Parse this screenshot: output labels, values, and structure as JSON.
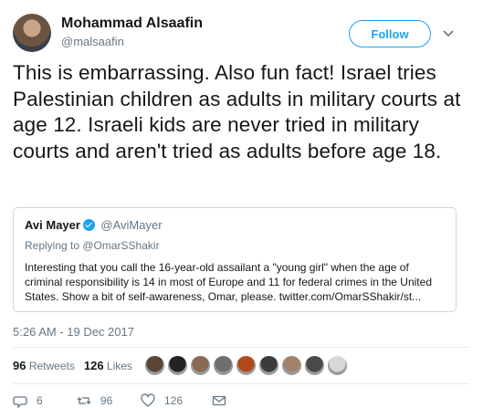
{
  "author": {
    "name": "Mohammad Alsaafin",
    "handle": "@malsaafin",
    "follow_label": "Follow"
  },
  "tweet": {
    "text": "This is embarrassing. Also fun fact! Israel tries Palestinian children as adults in military courts at age 12. Israeli kids are never tried in military courts and aren't tried as adults before age 18.",
    "timestamp": "5:26 AM - 19 Dec 2017"
  },
  "quoted_tweet": {
    "name": "Avi Mayer",
    "handle": "@AviMayer",
    "replying_to": "Replying to @OmarSShakir",
    "text": "Interesting that you call the 16-year-old assailant a \"young girl\" when the age of criminal responsibility is 14 in most of Europe and 11 for federal crimes in the United States. Show a bit of self-awareness, Omar, please. twitter.com/OmarSShakir/st..."
  },
  "stats": {
    "retweets_count": "96",
    "retweets_label": "Retweets",
    "likes_count": "126",
    "likes_label": "Likes"
  },
  "likers": [
    {
      "color": "#5a4636"
    },
    {
      "color": "#222222"
    },
    {
      "color": "#8a6a55"
    },
    {
      "color": "#6e6e6e"
    },
    {
      "color": "#b04a1c"
    },
    {
      "color": "#3b3b3b"
    },
    {
      "color": "#a3826a"
    },
    {
      "color": "#4a4a4a"
    },
    {
      "color": "#d8d8d8"
    }
  ],
  "actions": {
    "replies": "6",
    "retweets": "96",
    "likes": "126"
  },
  "colors": {
    "accent": "#1da1f2",
    "secondary_text": "#657786",
    "border": "#ccd6dd"
  }
}
